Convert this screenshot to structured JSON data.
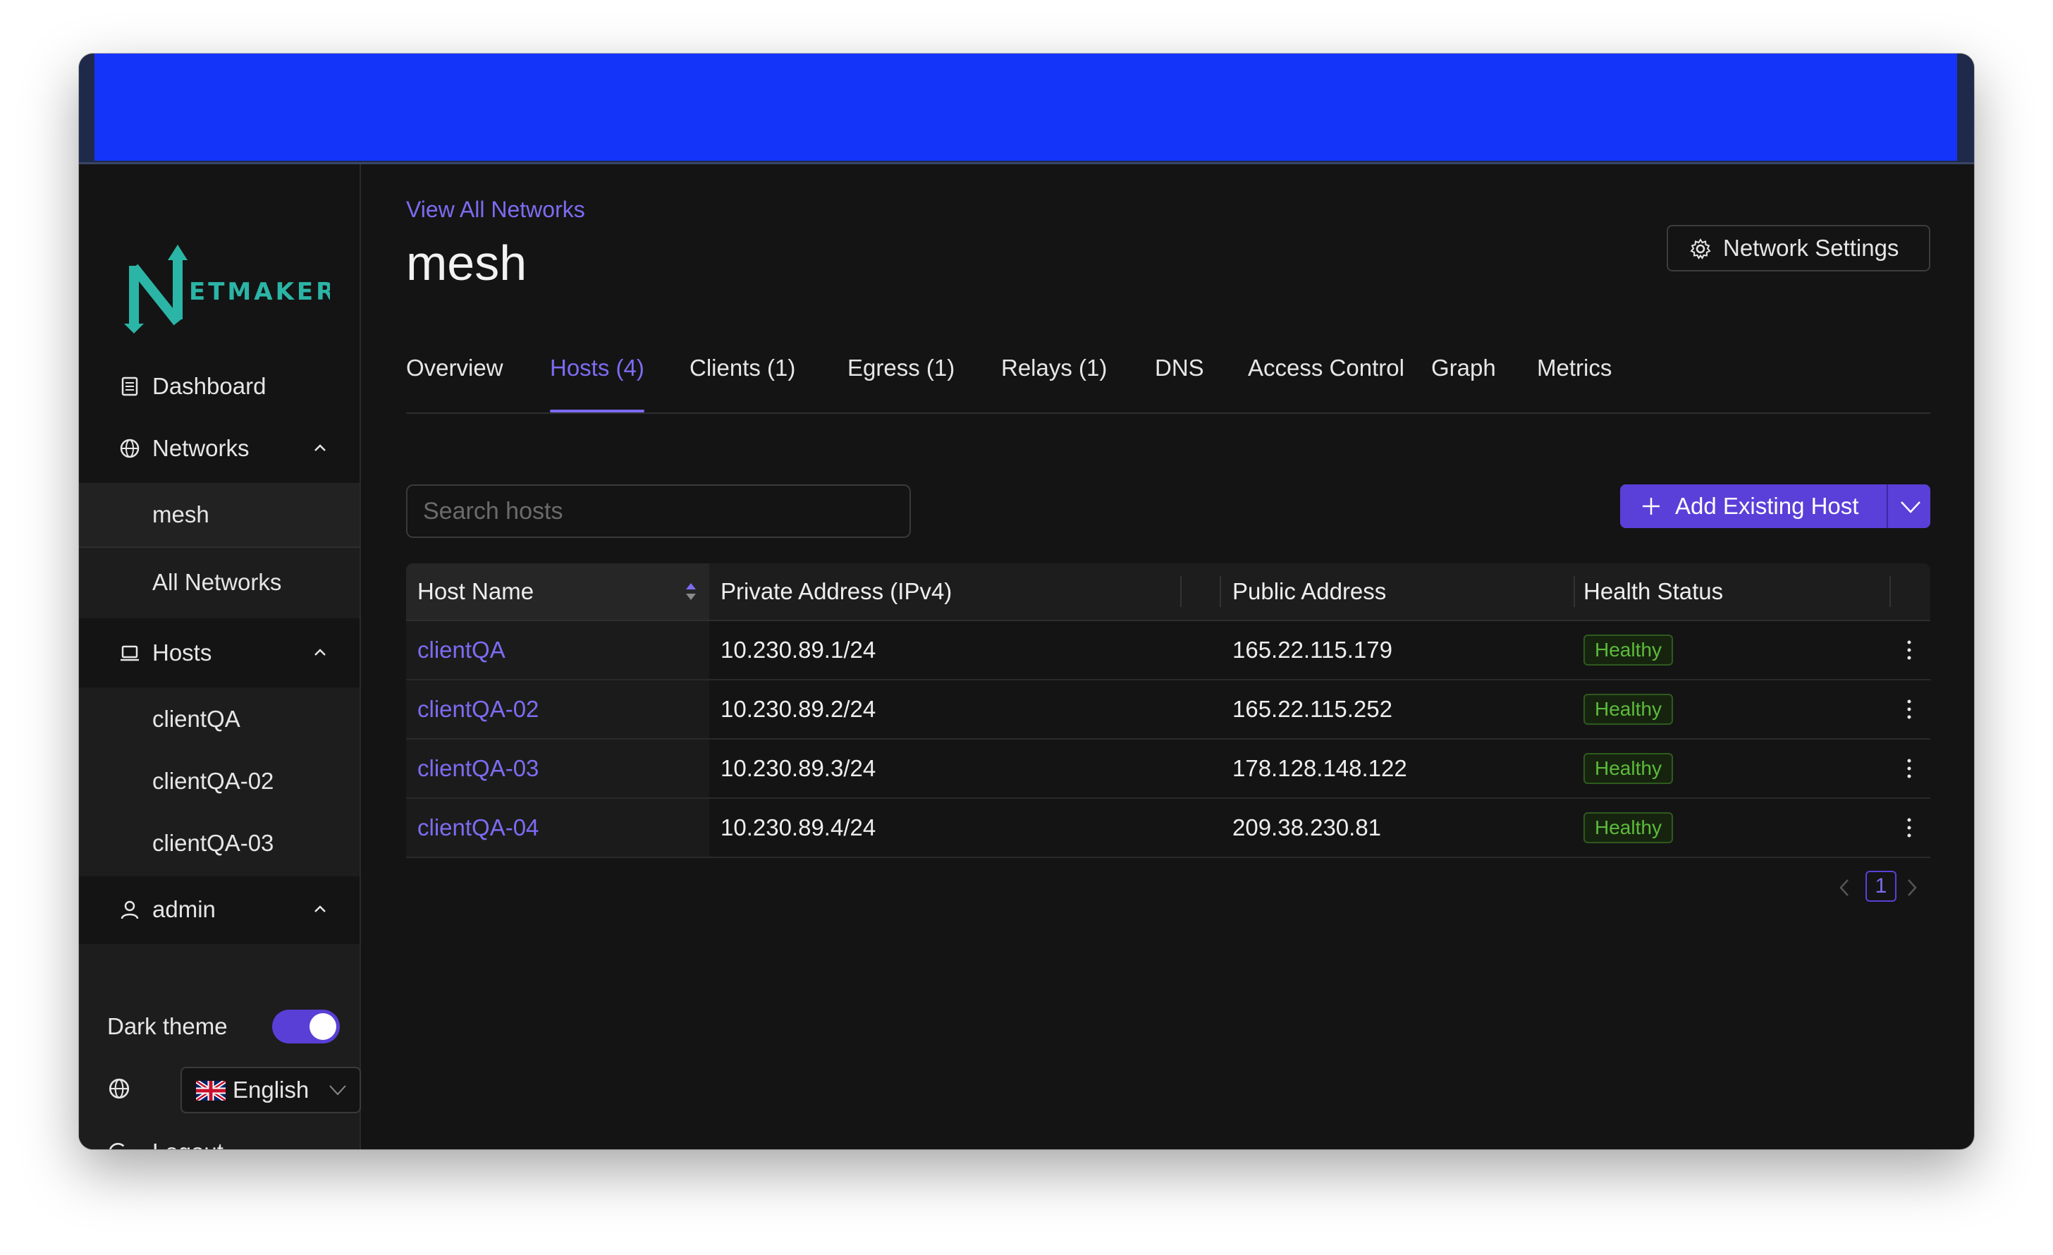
{
  "colors": {
    "accent": "#5b3fd9",
    "link": "#7c6cf2",
    "topbar": "#1534f9",
    "healthy": "#5dbb3b",
    "background": "#141414"
  },
  "brand": {
    "logo_text": "ETMAKER",
    "logo_letter": "N"
  },
  "sidebar": {
    "dashboard": "Dashboard",
    "networks": "Networks",
    "network_items": [
      "mesh",
      "All Networks"
    ],
    "hosts": "Hosts",
    "host_items": [
      "clientQA",
      "clientQA-02",
      "clientQA-03"
    ],
    "user": "admin",
    "dark_theme_label": "Dark theme",
    "dark_theme_on": true,
    "language": "English",
    "logout": "Logout"
  },
  "header": {
    "breadcrumb": "View All Networks",
    "title": "mesh",
    "settings_button": "Network Settings"
  },
  "tabs": [
    "Overview",
    "Hosts (4)",
    "Clients (1)",
    "Egress (1)",
    "Relays (1)",
    "DNS",
    "Access Control",
    "Graph",
    "Metrics"
  ],
  "active_tab": "Hosts (4)",
  "search": {
    "placeholder": "Search hosts",
    "value": ""
  },
  "add_button": "Add Existing Host",
  "table": {
    "columns": [
      "Host Name",
      "Private Address (IPv4)",
      "Public Address",
      "Health Status"
    ],
    "rows": [
      {
        "name": "clientQA",
        "private": "10.230.89.1/24",
        "public": "165.22.115.179",
        "status": "Healthy"
      },
      {
        "name": "clientQA-02",
        "private": "10.230.89.2/24",
        "public": "165.22.115.252",
        "status": "Healthy"
      },
      {
        "name": "clientQA-03",
        "private": "10.230.89.3/24",
        "public": "178.128.148.122",
        "status": "Healthy"
      },
      {
        "name": "clientQA-04",
        "private": "10.230.89.4/24",
        "public": "209.38.230.81",
        "status": "Healthy"
      }
    ]
  },
  "pagination": {
    "current": "1"
  }
}
